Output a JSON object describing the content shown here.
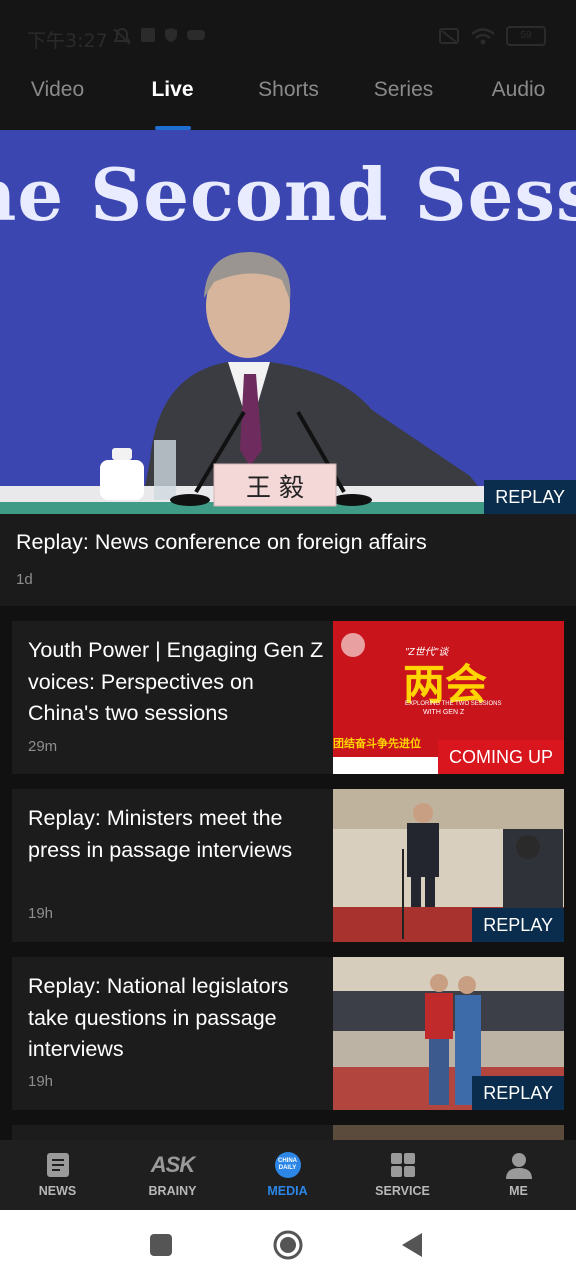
{
  "status": {
    "time": "下午3:27",
    "battery": "59"
  },
  "tabs": [
    {
      "label": "Video"
    },
    {
      "label": "Live"
    },
    {
      "label": "Shorts"
    },
    {
      "label": "Series"
    },
    {
      "label": "Audio"
    }
  ],
  "active_tab": "Live",
  "hero": {
    "banner_text": "he Second Session o",
    "nameplate": "王 毅",
    "badge": "REPLAY",
    "title": "Replay: News conference on foreign affairs",
    "time": "1d"
  },
  "cards": [
    {
      "title": "Youth Power | Engaging Gen Z voices: Perspectives on China's two sessions",
      "time": "29m",
      "badge": "COMING UP",
      "thumb_text": {
        "main": "两会",
        "top": "\"Z世代\"谈",
        "sub": "EXPLORING THE TWO SESSIONS",
        "sub2": "WITH GEN Z",
        "bottom": "团结奋斗争先进位"
      }
    },
    {
      "title": "Replay: Ministers meet the press in passage interviews",
      "time": "19h",
      "badge": "REPLAY"
    },
    {
      "title": "Replay: National legislators take questions in passage interviews",
      "time": "19h",
      "badge": "REPLAY"
    }
  ],
  "bottom_nav": [
    {
      "label": "NEWS",
      "icon": "news-icon"
    },
    {
      "label": "BRAINY",
      "icon": "ask-brainy-icon",
      "icon_text": "ASK"
    },
    {
      "label": "MEDIA",
      "icon": "china-daily-icon",
      "icon_text": "CHINA DAILY"
    },
    {
      "label": "SERVICE",
      "icon": "grid-icon"
    },
    {
      "label": "ME",
      "icon": "person-icon"
    }
  ],
  "colors": {
    "accent": "#2b86e6",
    "replay_badge": "#0b2d4d",
    "coming_badge": "#d9151d"
  }
}
